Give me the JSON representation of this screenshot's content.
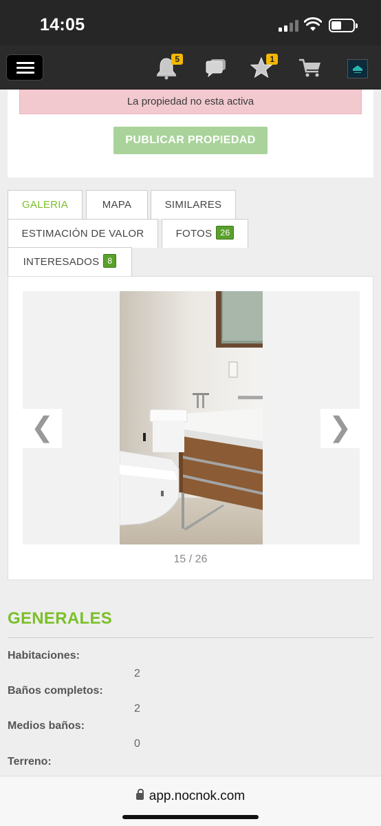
{
  "status_bar": {
    "time": "14:05"
  },
  "header": {
    "notifications_count": "5",
    "favorites_count": "1"
  },
  "alert": {
    "message": "La propiedad no esta activa"
  },
  "publish_button": {
    "label": "PUBLICAR PROPIEDAD"
  },
  "tabs": [
    {
      "label": "GALERIA",
      "active": true
    },
    {
      "label": "MAPA"
    },
    {
      "label": "SIMILARES"
    },
    {
      "label": "ESTIMACIÓN DE VALOR"
    },
    {
      "label": "FOTOS",
      "badge": "26"
    },
    {
      "label": "INTERESADOS",
      "badge": "8"
    }
  ],
  "gallery": {
    "prev_glyph": "❮",
    "next_glyph": "❯",
    "counter": "15 / 26"
  },
  "generales": {
    "title": "GENERALES",
    "fields": [
      {
        "label": "Habitaciones:",
        "value": "2"
      },
      {
        "label": "Baños completos:",
        "value": "2"
      },
      {
        "label": "Medios baños:",
        "value": "0"
      },
      {
        "label": "Terreno:",
        "value": ""
      }
    ]
  },
  "browser": {
    "url": "app.nocnok.com"
  },
  "colors": {
    "accent_green": "#7bbf2a",
    "badge_green": "#5aa02c",
    "alert_bg": "#f2c9cf",
    "publish_bg": "#a9d39a",
    "badge_yellow": "#f5b800"
  }
}
